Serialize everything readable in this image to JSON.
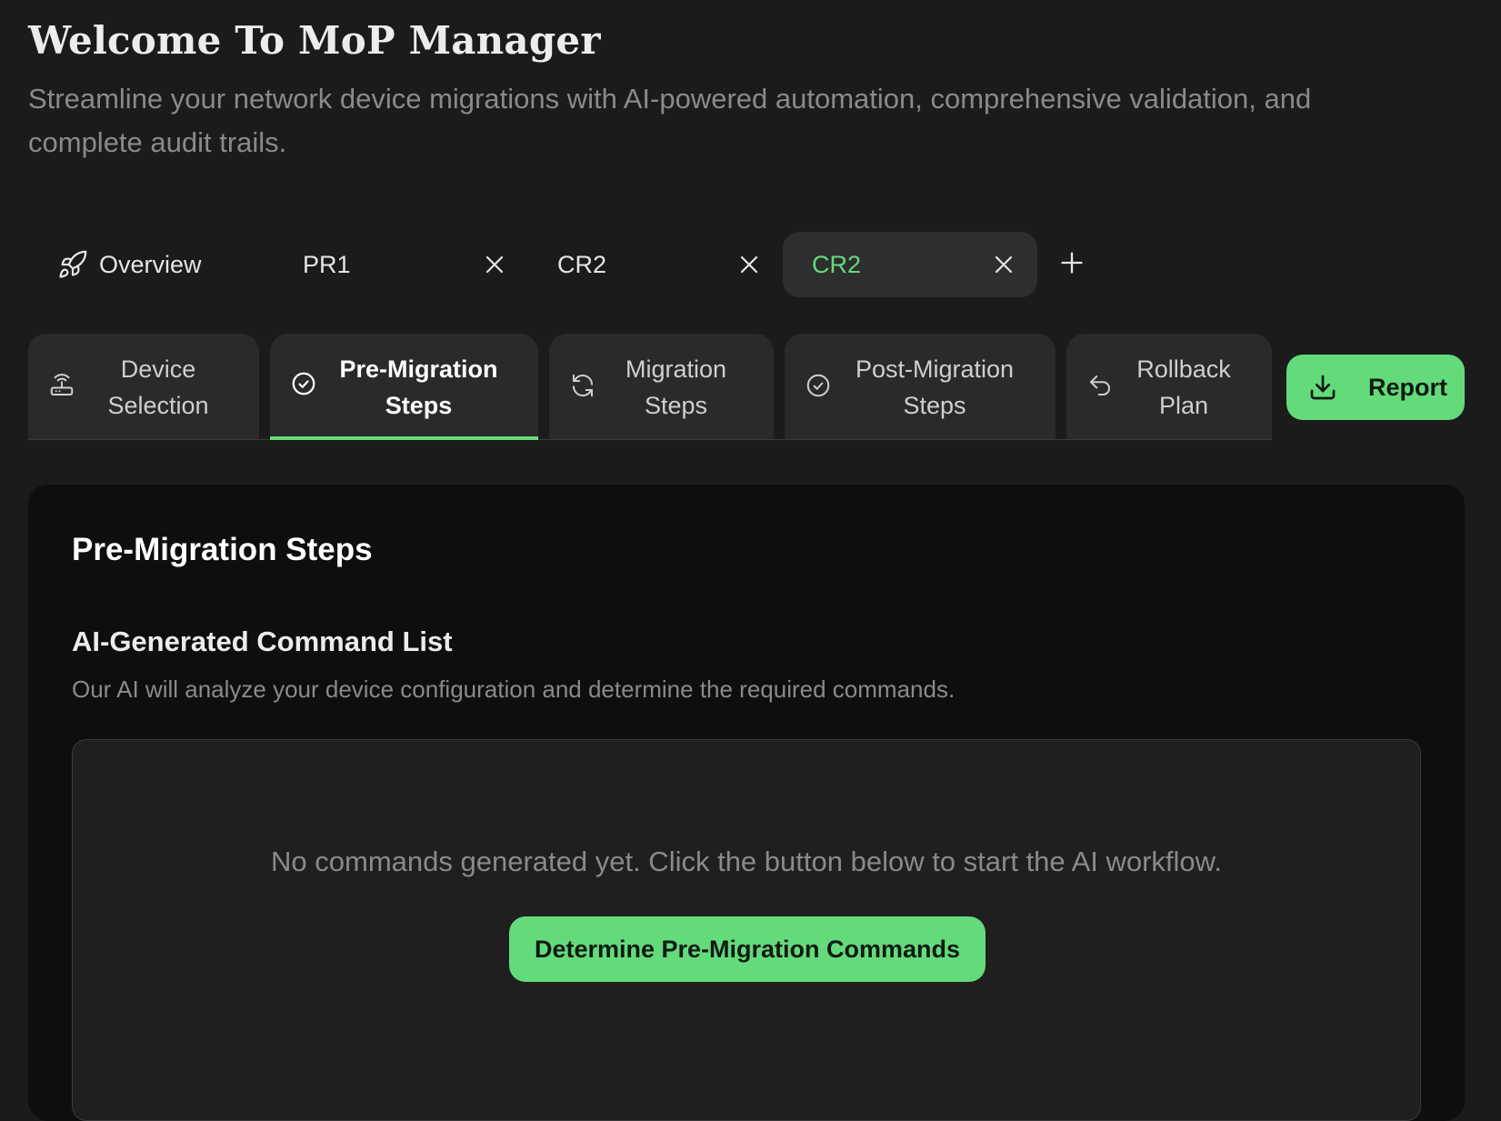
{
  "app": {
    "title": "Welcome To MoP Manager",
    "subtitle": "Streamline your network device migrations with AI-powered automation, comprehensive validation, and complete audit trails."
  },
  "workspace_tabs": {
    "overview": {
      "label": "Overview",
      "icon": "rocket-icon"
    },
    "documents": [
      {
        "label": "PR1",
        "active": false
      },
      {
        "label": "CR2",
        "active": false
      },
      {
        "label": "CR2",
        "active": true
      }
    ],
    "add_icon": "plus-icon"
  },
  "step_tabs": [
    {
      "label": "Device Selection",
      "icon": "router-icon",
      "active": false
    },
    {
      "label": "Pre-Migration Steps",
      "icon": "check-circle-icon",
      "active": true
    },
    {
      "label": "Migration Steps",
      "icon": "refresh-icon",
      "active": false
    },
    {
      "label": "Post-Migration Steps",
      "icon": "check-circle-icon",
      "active": false
    },
    {
      "label": "Rollback Plan",
      "icon": "undo-icon",
      "active": false
    }
  ],
  "report_button": {
    "label": "Report",
    "icon": "download-icon"
  },
  "panel": {
    "title": "Pre-Migration Steps",
    "section_title": "AI-Generated Command List",
    "section_desc": "Our AI will analyze your device configuration and determine the required commands.",
    "empty_message": "No commands generated yet. Click the button below to start the AI workflow.",
    "action_label": "Determine Pre-Migration Commands"
  },
  "colors": {
    "background": "#1b1b1b",
    "panel": "#0e0e0e",
    "accent": "#64db7b",
    "muted_text": "#8a8a8a"
  }
}
